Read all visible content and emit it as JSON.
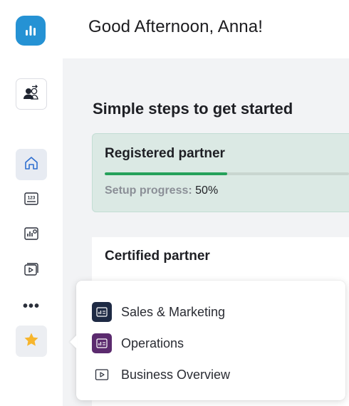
{
  "header": {
    "greeting": "Good Afternoon, Anna!"
  },
  "sidebar": {
    "items": [
      {
        "name": "logo-icon"
      },
      {
        "name": "account-switch-icon"
      },
      {
        "name": "home-icon",
        "active": true
      },
      {
        "name": "number-widget-icon",
        "text": "123"
      },
      {
        "name": "dashboard-icon"
      },
      {
        "name": "presentation-icon"
      },
      {
        "name": "more-icon",
        "text": "•••"
      },
      {
        "name": "star-icon"
      }
    ]
  },
  "main": {
    "section_title": "Simple steps to get started",
    "cards": [
      {
        "title": "Registered partner",
        "progress_label": "Setup progress:",
        "progress_value": "50%",
        "progress_fraction": 0.5
      },
      {
        "title": "Certified partner"
      }
    ]
  },
  "favorites_menu": {
    "items": [
      {
        "label": "Sales & Marketing",
        "icon": "dashboard-icon",
        "color": "#1e2a44"
      },
      {
        "label": "Operations",
        "icon": "dashboard-icon",
        "color": "#5b2a6e"
      },
      {
        "label": "Business Overview",
        "icon": "presentation-icon",
        "color": "#ffffff"
      }
    ]
  },
  "colors": {
    "brand": "#2592d4",
    "progress": "#25a15a",
    "card_success_bg": "#dbe9e4",
    "star": "#f7b52c"
  }
}
